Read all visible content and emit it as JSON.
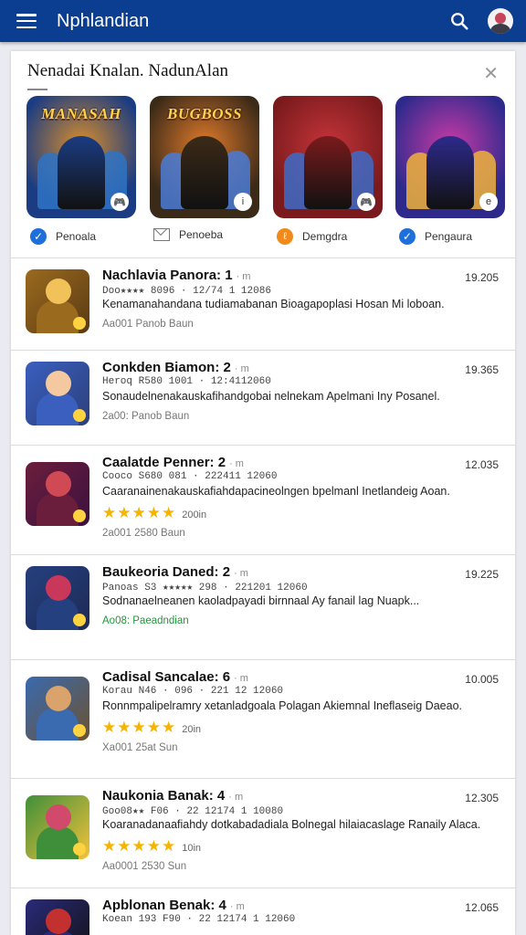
{
  "header": {
    "title": "Nphlandian",
    "icons": [
      "menu-icon",
      "search-icon",
      "avatar"
    ]
  },
  "featured": {
    "title": "Nenadai Knalan. NadunAlan",
    "cards": [
      {
        "label": "MANASAH",
        "badge": "🎮",
        "caption": "Penoala",
        "caption_icon": "check-icon",
        "colors": [
          "#1b3c82",
          "#d98d2b",
          "#2e73c6"
        ]
      },
      {
        "label": "BUGBOSS",
        "badge": "i",
        "caption": "Penoeba",
        "caption_icon": "mail-icon",
        "colors": [
          "#3b2a18",
          "#e07a2b",
          "#4a7bd6"
        ]
      },
      {
        "label": "",
        "badge": "🎮",
        "caption": "Demgdra",
        "caption_icon": "coin-icon",
        "colors": [
          "#7a1a1c",
          "#c4343a",
          "#3d6bc7"
        ]
      },
      {
        "label": "",
        "badge": "e",
        "caption": "Pengaura",
        "caption_icon": "check-icon",
        "colors": [
          "#2d2a8c",
          "#c93aa6",
          "#f0b23b"
        ]
      }
    ]
  },
  "apps": [
    {
      "name": "Nachlavia Panora",
      "num": "1",
      "stat": "Doo★★★★ 8096 · 12/74 1 12086",
      "desc": "Kenamanahandana tudiamabanan Bioagapoplasi Hosan Mi loboan.",
      "stars": "",
      "stars_count": "",
      "footer": "Aa001 Panob Baun",
      "footer_green": false,
      "price": "19.205",
      "colors": [
        "#9a6a1e",
        "#f1c25a",
        "#5a3a14"
      ]
    },
    {
      "name": "Conkden Biamon",
      "num": "2",
      "stat": "Heroq R580 1001 · 12:4112060",
      "desc": "Sonaudelnenakauskafihandgobai nelnekam Apelmani Iny Posanel.",
      "stars": "",
      "stars_count": "",
      "footer": "2a00: Panob Baun",
      "footer_green": false,
      "price": "19.365",
      "colors": [
        "#3a5fbf",
        "#f4c9a0",
        "#2c3f7a"
      ]
    },
    {
      "name": "Caalatde Penner",
      "num": "2",
      "stat": "Cooco S680 081 · 222411 12060",
      "desc": "Caaranainenakauskafiahdapacineolngen bpelmanl Inetlandeig Aoan.",
      "stars": "★★★★★",
      "stars_count": "200in",
      "footer": "2a001 2580 Baun",
      "footer_green": false,
      "price": "12.035",
      "colors": [
        "#6b1e3c",
        "#d04a55",
        "#3b1140"
      ]
    },
    {
      "name": "Baukeoria Daned",
      "num": "2",
      "stat": "Panoas S3 ★★★★★ 298 · 221201 12060",
      "desc": "Sodnanaelneanen kaoladpayadi birnnaal Ay fanail lag Nuapk...",
      "stars": "",
      "stars_count": "",
      "footer": "Ao08: Paeadndian",
      "footer_green": true,
      "price": "19.225",
      "colors": [
        "#25407f",
        "#c9375a",
        "#1d2a55"
      ]
    },
    {
      "name": "Cadisal Sancalae",
      "num": "6",
      "stat": "Korau N46 · 096 · 221 12 12060",
      "desc": "Ronnmpalipelramry xetanladgoala Polagan Akiemnal Ineflaseig Daeao.",
      "stars": "★★★★★",
      "stars_count": "20in",
      "footer": "Xa001 25at Sun",
      "footer_green": false,
      "price": "10.005",
      "colors": [
        "#3a6ab0",
        "#d9a36b",
        "#6b5230"
      ]
    },
    {
      "name": "Naukonia Banak",
      "num": "4",
      "stat": "Goo08★★ F06 · 22 12174 1 10080",
      "desc": "Koaranadanaafiahdy dotkabadadiala Bolnegal hilaiacaslage Ranaily Alaca.",
      "stars": "★★★★★",
      "stars_count": "10in",
      "footer": "Aa0001 2530 Sun",
      "footer_green": false,
      "price": "12.305",
      "colors": [
        "#3f8f3a",
        "#d24a6b",
        "#f3c23a"
      ]
    },
    {
      "name": "Apblonan Benak",
      "num": "4",
      "stat": "Koean 193 F90 · 22 12174 1 12060",
      "desc": "",
      "stars": "",
      "stars_count": "",
      "footer": "",
      "footer_green": false,
      "price": "12.065",
      "colors": [
        "#2a2a7a",
        "#c23030",
        "#111"
      ]
    }
  ]
}
